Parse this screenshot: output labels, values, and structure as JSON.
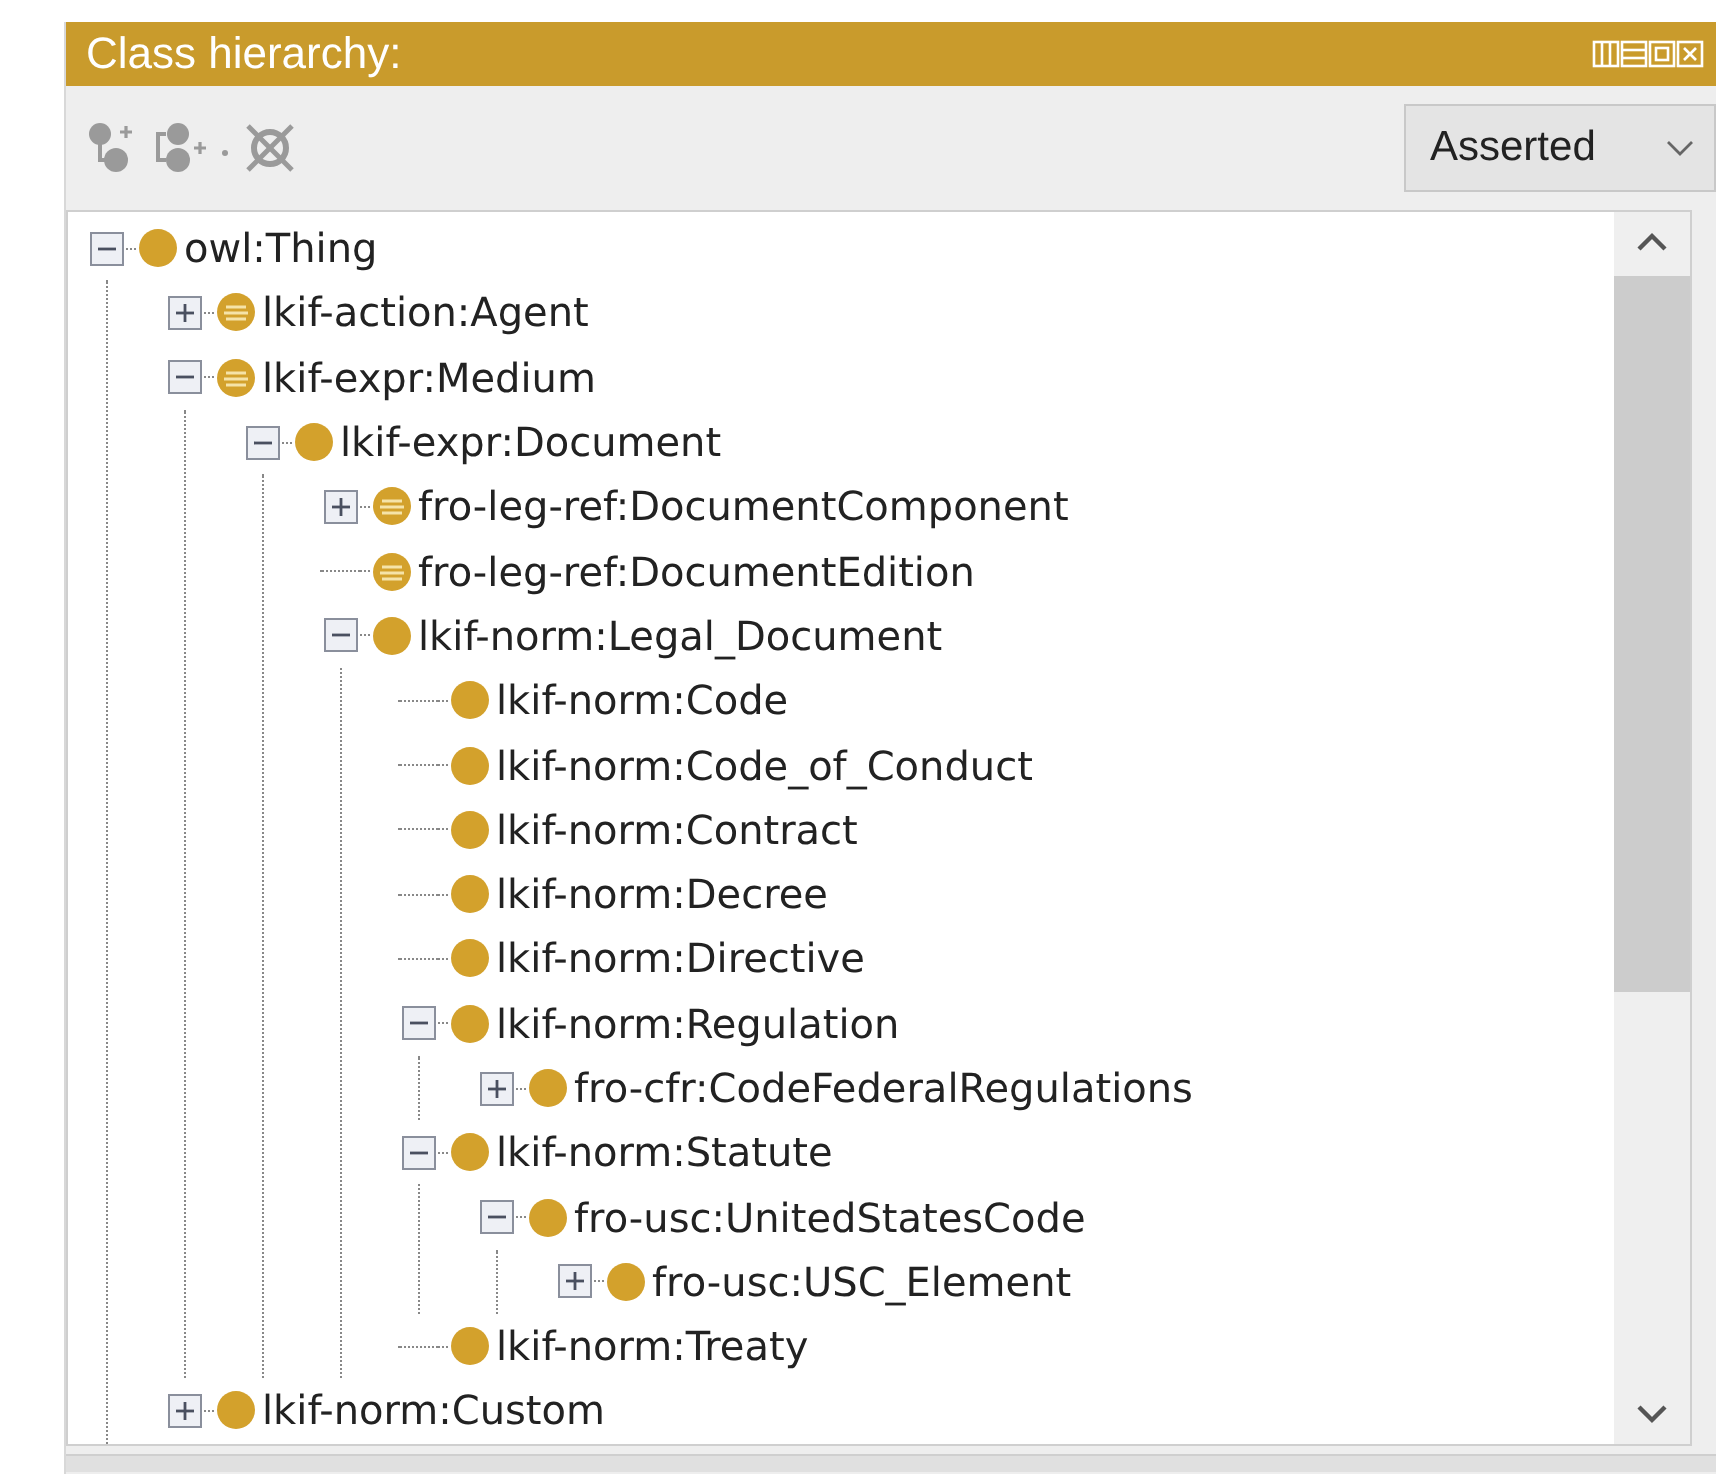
{
  "panel": {
    "title": "Class hierarchy:"
  },
  "toolbar": {
    "view_dropdown": {
      "value": "Asserted"
    }
  },
  "tree": [
    {
      "label": "owl:Thing",
      "kind": "primitive",
      "expanded": true,
      "children": [
        {
          "label": "lkif-action:Agent",
          "kind": "defined",
          "expanded": false
        },
        {
          "label": "lkif-expr:Medium",
          "kind": "defined",
          "expanded": true,
          "children": [
            {
              "label": "lkif-expr:Document",
              "kind": "primitive",
              "expanded": true,
              "children": [
                {
                  "label": "fro-leg-ref:DocumentComponent",
                  "kind": "defined",
                  "expanded": false
                },
                {
                  "label": "fro-leg-ref:DocumentEdition",
                  "kind": "defined"
                },
                {
                  "label": "lkif-norm:Legal_Document",
                  "kind": "primitive",
                  "expanded": true,
                  "children": [
                    {
                      "label": "lkif-norm:Code",
                      "kind": "primitive"
                    },
                    {
                      "label": "lkif-norm:Code_of_Conduct",
                      "kind": "primitive"
                    },
                    {
                      "label": "lkif-norm:Contract",
                      "kind": "primitive"
                    },
                    {
                      "label": "lkif-norm:Decree",
                      "kind": "primitive"
                    },
                    {
                      "label": "lkif-norm:Directive",
                      "kind": "primitive"
                    },
                    {
                      "label": "lkif-norm:Regulation",
                      "kind": "primitive",
                      "expanded": true,
                      "children": [
                        {
                          "label": "fro-cfr:CodeFederalRegulations",
                          "kind": "primitive",
                          "expanded": false
                        }
                      ]
                    },
                    {
                      "label": "lkif-norm:Statute",
                      "kind": "primitive",
                      "expanded": true,
                      "children": [
                        {
                          "label": "fro-usc:UnitedStatesCode",
                          "kind": "primitive",
                          "expanded": true,
                          "children": [
                            {
                              "label": "fro-usc:USC_Element",
                              "kind": "primitive",
                              "expanded": false
                            }
                          ]
                        }
                      ]
                    },
                    {
                      "label": "lkif-norm:Treaty",
                      "kind": "primitive"
                    }
                  ]
                }
              ]
            }
          ]
        },
        {
          "label": "lkif-norm:Custom",
          "kind": "primitive",
          "expanded": false
        }
      ]
    }
  ]
}
